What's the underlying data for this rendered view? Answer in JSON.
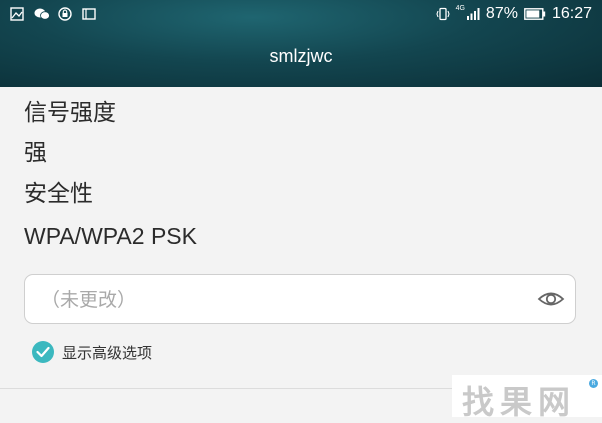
{
  "status_bar": {
    "left_icons": [
      "image-icon",
      "wechat-icon",
      "vpn-icon",
      "tablet-icon"
    ],
    "network_type": "4G",
    "battery_percent": "87%",
    "battery_level": 0.87,
    "time": "16:27"
  },
  "header": {
    "title": "smlzjwc"
  },
  "info": {
    "signal_label": "信号强度",
    "signal_value": "强",
    "security_label": "安全性",
    "security_value": "WPA/WPA2 PSK"
  },
  "password": {
    "value": "",
    "placeholder": "（未更改）",
    "icon": "eye-icon"
  },
  "advanced": {
    "label": "显示高级选项",
    "checked": true
  },
  "watermark": {
    "text": "找果网"
  },
  "colors": {
    "accent": "#3bb8bf",
    "header_dark": "#0b2e36",
    "header_light": "#1f6570",
    "background": "#f3f3f3"
  }
}
